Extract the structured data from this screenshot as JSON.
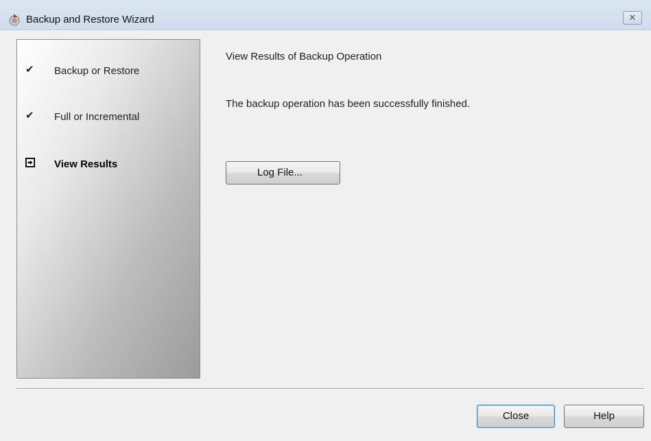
{
  "window": {
    "title": "Backup and Restore Wizard",
    "close_glyph": "✕"
  },
  "steps": [
    {
      "label": "Backup or Restore",
      "status": "done",
      "icon": "checkmark-icon"
    },
    {
      "label": "Full or Incremental",
      "status": "done",
      "icon": "checkmark-icon"
    },
    {
      "label": "View Results",
      "status": "current",
      "icon": "arrow-right-icon"
    }
  ],
  "content": {
    "title": "View Results of Backup Operation",
    "message": "The backup operation has been successfully finished.",
    "log_button": "Log File..."
  },
  "footer": {
    "close_label": "Close",
    "help_label": "Help"
  },
  "colors": {
    "titlebar": "#dce6f2",
    "window_bg": "#f0f0f0",
    "default_button_border": "#3c7fb1"
  }
}
